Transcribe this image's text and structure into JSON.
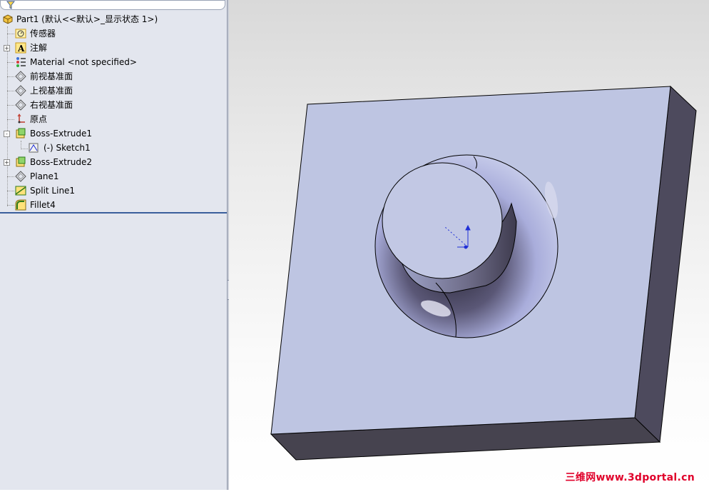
{
  "feature_tree": {
    "root": {
      "label": "Part1  (默认<<默认>_显示状态 1>)",
      "icon": "part-icon"
    },
    "items": [
      {
        "label": "传感器",
        "icon": "sensors-icon",
        "expander": ""
      },
      {
        "label": "注解",
        "icon": "annotations-icon",
        "expander": "+"
      },
      {
        "label": "Material <not specified>",
        "icon": "material-icon",
        "expander": ""
      },
      {
        "label": "前视基准面",
        "icon": "plane-icon",
        "expander": ""
      },
      {
        "label": "上视基准面",
        "icon": "plane-icon",
        "expander": ""
      },
      {
        "label": "右视基准面",
        "icon": "plane-icon",
        "expander": ""
      },
      {
        "label": "原点",
        "icon": "origin-icon",
        "expander": ""
      },
      {
        "label": "Boss-Extrude1",
        "icon": "extrude-icon",
        "expander": "-"
      },
      {
        "label": "(-) Sketch1",
        "icon": "sketch-icon",
        "expander": ""
      },
      {
        "label": "Boss-Extrude2",
        "icon": "extrude-icon",
        "expander": "+"
      },
      {
        "label": "Plane1",
        "icon": "plane-icon",
        "expander": ""
      },
      {
        "label": "Split Line1",
        "icon": "split-line-icon",
        "expander": ""
      },
      {
        "label": "Fillet4",
        "icon": "fillet-icon",
        "expander": ""
      }
    ]
  },
  "viewport": {
    "watermark": "三维网www.3dportal.cn",
    "colors": {
      "plate_top": "#bec5e2",
      "plate_side_dark": "#4d4a5d",
      "plate_front": "#46434f",
      "boss_top": "#c2c8e4",
      "triad_blue": "#1f2fd6",
      "watermark_red": "#e0002a"
    }
  },
  "filter": {
    "icon": "filter-icon"
  }
}
